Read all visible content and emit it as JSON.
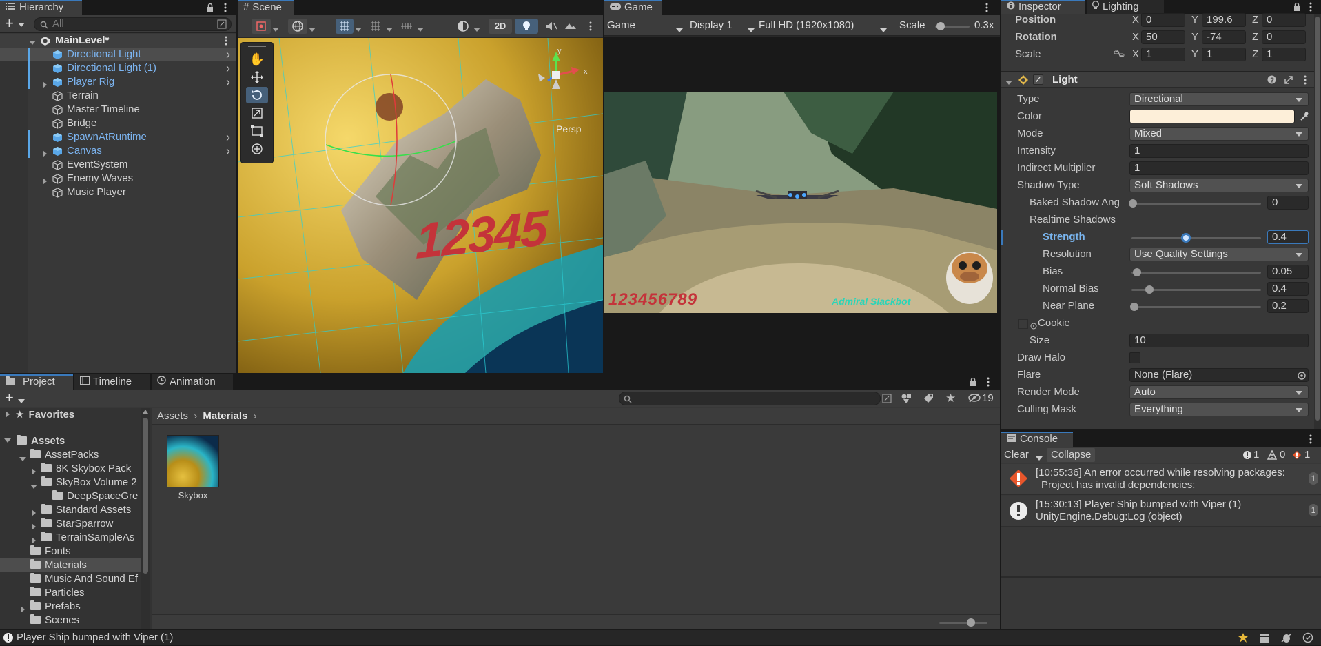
{
  "hierarchy": {
    "tab": "Hierarchy",
    "search_placeholder": "All",
    "scene": "MainLevel*",
    "items": [
      {
        "label": "Directional Light",
        "prefab": true,
        "arrow": true,
        "selected": true
      },
      {
        "label": "Directional Light (1)",
        "prefab": true,
        "arrow": true
      },
      {
        "label": "Player Rig",
        "prefab": true,
        "arrow": true,
        "expander": true
      },
      {
        "label": "Terrain"
      },
      {
        "label": "Master Timeline"
      },
      {
        "label": "Bridge"
      },
      {
        "label": "SpawnAtRuntime",
        "prefab": true,
        "arrow": true
      },
      {
        "label": "Canvas",
        "prefab": true,
        "arrow": true,
        "expander": true
      },
      {
        "label": "EventSystem"
      },
      {
        "label": "Enemy Waves",
        "expander": true
      },
      {
        "label": "Music Player"
      }
    ]
  },
  "scene": {
    "tab": "Scene",
    "toggle_2d": "2D",
    "overlay_text": "12345",
    "persp_label": "Persp"
  },
  "game": {
    "tab": "Game",
    "mode": "Game",
    "display": "Display 1",
    "resolution": "Full HD (1920x1080)",
    "scale_label": "Scale",
    "scale_value": "0.3x",
    "hud_score": "123456789",
    "hud_name": "Admiral Slackbot"
  },
  "inspector": {
    "tab": "Inspector",
    "tab2": "Lighting",
    "transform": {
      "position_label": "Position",
      "position": [
        "0",
        "199.6",
        "0"
      ],
      "rotation_label": "Rotation",
      "rotation": [
        "50",
        "-74",
        "0"
      ],
      "scale_label": "Scale",
      "scale": [
        "1",
        "1",
        "1"
      ]
    },
    "light": {
      "title": "Light",
      "type_label": "Type",
      "type": "Directional",
      "color_label": "Color",
      "color": "#fdefd9",
      "mode_label": "Mode",
      "mode": "Mixed",
      "intensity_label": "Intensity",
      "intensity": "1",
      "indirect_label": "Indirect Multiplier",
      "indirect": "1",
      "shadow_type_label": "Shadow Type",
      "shadow_type": "Soft Shadows",
      "baked_angle_label": "Baked Shadow Ang",
      "baked_angle": "0",
      "realtime_label": "Realtime Shadows",
      "strength_label": "Strength",
      "strength": "0.4",
      "resolution_label": "Resolution",
      "resolution": "Use Quality Settings",
      "bias_label": "Bias",
      "bias": "0.05",
      "normal_bias_label": "Normal Bias",
      "normal_bias": "0.4",
      "near_plane_label": "Near Plane",
      "near_plane": "0.2",
      "cookie_label": "Cookie",
      "size_label": "Size",
      "size": "10",
      "draw_halo_label": "Draw Halo",
      "flare_label": "Flare",
      "flare": "None (Flare)",
      "render_mode_label": "Render Mode",
      "render_mode": "Auto",
      "culling_label": "Culling Mask",
      "culling": "Everything"
    }
  },
  "project": {
    "tabs": [
      "Project",
      "Timeline",
      "Animation"
    ],
    "hidden_count": "19",
    "favorites": "Favorites",
    "assets": "Assets",
    "tree": [
      {
        "label": "AssetPacks"
      },
      {
        "label": "8K Skybox Pack"
      },
      {
        "label": "SkyBox Volume 2"
      },
      {
        "label": "DeepSpaceGre"
      },
      {
        "label": "Standard Assets"
      },
      {
        "label": "StarSparrow"
      },
      {
        "label": "TerrainSampleAs"
      },
      {
        "label": "Fonts"
      },
      {
        "label": "Materials"
      },
      {
        "label": "Music And Sound Ef"
      },
      {
        "label": "Particles"
      },
      {
        "label": "Prefabs"
      },
      {
        "label": "Scenes"
      }
    ],
    "breadcrumb": [
      "Assets",
      "Materials"
    ],
    "asset": "Skybox"
  },
  "console": {
    "tab": "Console",
    "clear": "Clear",
    "collapse": "Collapse",
    "count_info": "1",
    "count_warn": "0",
    "count_err": "1",
    "entries": [
      {
        "line1": "[10:55:36] An error occurred while resolving packages:",
        "line2": "Project has invalid dependencies:",
        "count": "1",
        "type": "error"
      },
      {
        "line1": "[15:30:13] Player Ship bumped with Viper (1)",
        "line2": "UnityEngine.Debug:Log (object)",
        "count": "1",
        "type": "info"
      }
    ]
  },
  "status": {
    "message": "Player Ship bumped with Viper (1)"
  }
}
